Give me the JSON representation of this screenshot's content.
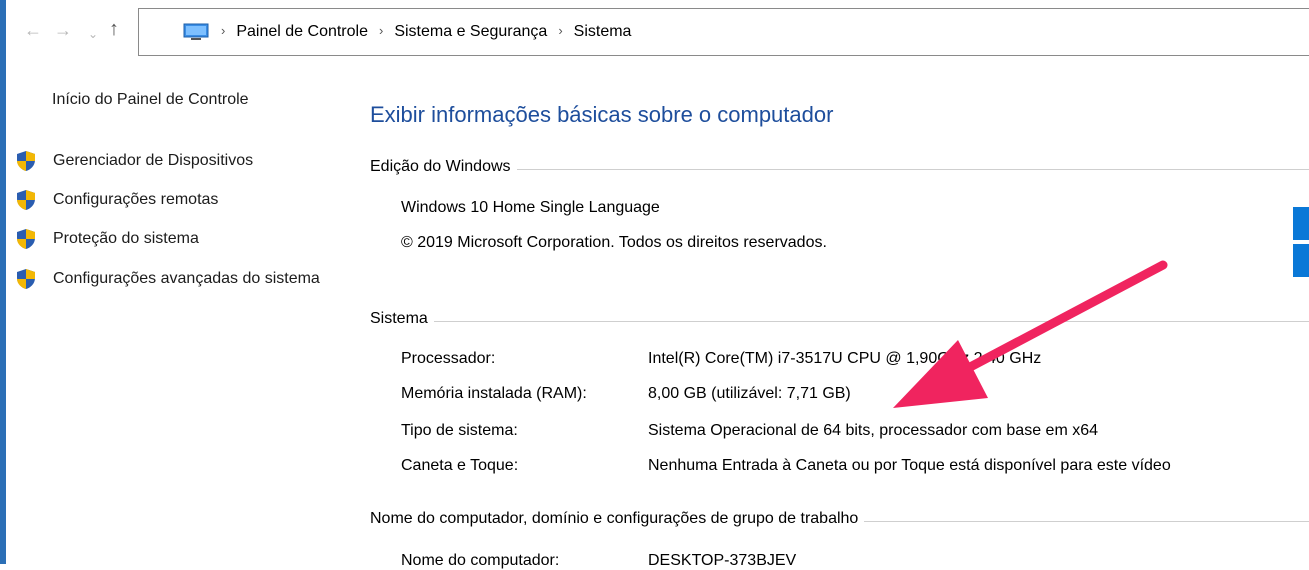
{
  "nav": {
    "back_glyph": "←",
    "forward_glyph": "→",
    "dropdown_glyph": "⌄",
    "up_glyph": "↑",
    "sep_glyph": "›",
    "breadcrumbs": [
      "Painel de Controle",
      "Sistema e Segurança",
      "Sistema"
    ]
  },
  "sidebar": {
    "home": "Início do Painel de Controle",
    "items": [
      {
        "label": "Gerenciador de Dispositivos",
        "icon": "shield-icon"
      },
      {
        "label": "Configurações remotas",
        "icon": "shield-icon"
      },
      {
        "label": "Proteção do sistema",
        "icon": "shield-icon"
      },
      {
        "label": "Configurações avançadas do sistema",
        "icon": "shield-icon"
      }
    ]
  },
  "main": {
    "title": "Exibir informações básicas sobre o computador",
    "edition": {
      "heading": "Edição do Windows",
      "product": "Windows 10 Home Single Language",
      "copyright": "© 2019 Microsoft Corporation. Todos os direitos reservados."
    },
    "system": {
      "heading": "Sistema",
      "rows": [
        {
          "label": "Processador:",
          "value": "Intel(R) Core(TM) i7-3517U CPU @ 1,90GHz   2.40 GHz"
        },
        {
          "label": "Memória instalada (RAM):",
          "value": "8,00 GB (utilizável: 7,71 GB)"
        },
        {
          "label": "Tipo de sistema:",
          "value": "Sistema Operacional de 64 bits, processador com base em x64"
        },
        {
          "label": "Caneta e Toque:",
          "value": "Nenhuma Entrada à Caneta ou por Toque está disponível para este vídeo"
        }
      ]
    },
    "computer": {
      "heading": "Nome do computador, domínio e configurações de grupo de trabalho",
      "rows": [
        {
          "label": "Nome do computador:",
          "value": "DESKTOP-373BJEV"
        }
      ]
    }
  },
  "colors": {
    "title_blue": "#1e4e9c",
    "window_border": "#2b6fb6",
    "annotation_arrow": "#f0245f",
    "windows_logo": "#0a78d7"
  }
}
